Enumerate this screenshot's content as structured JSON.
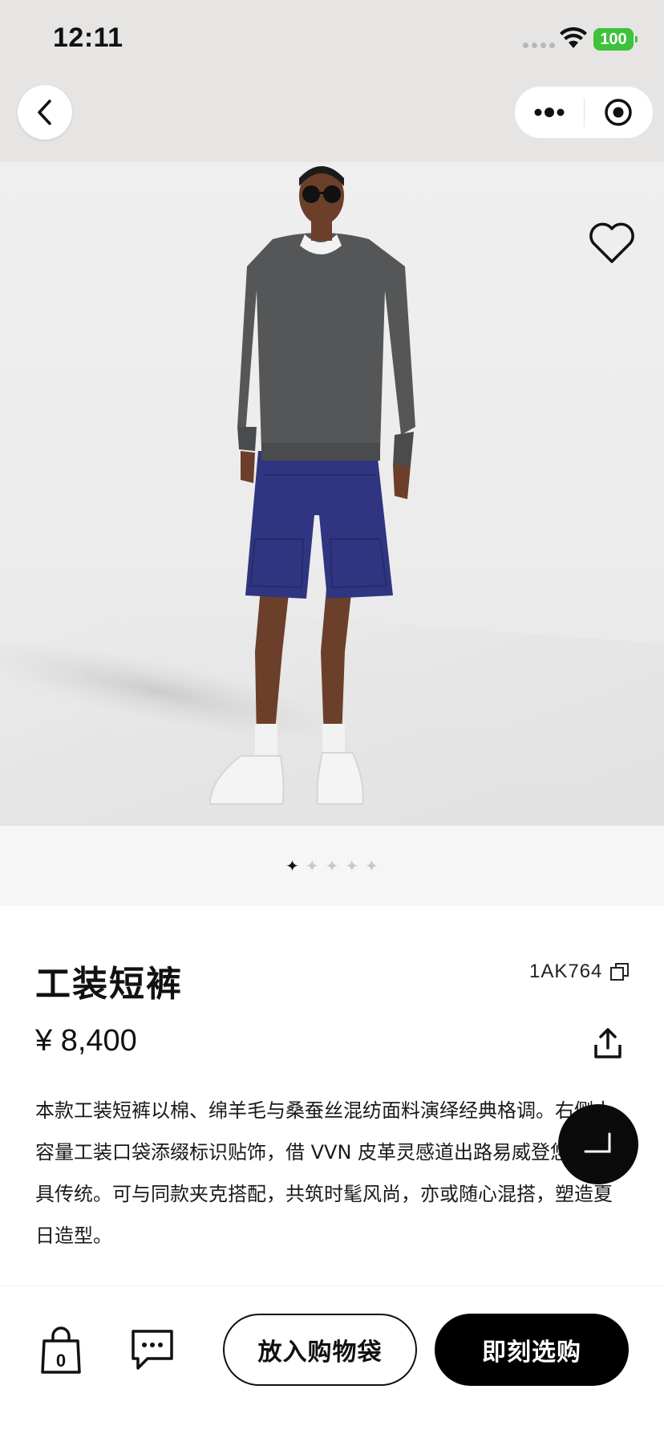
{
  "status_bar": {
    "time": "12:11",
    "battery": "100"
  },
  "product": {
    "title": "工装短裤",
    "sku": "1AK764",
    "price": "¥ 8,400",
    "description": "本款工装短裤以棉、绵羊毛与桑蚕丝混纺面料演绎经典格调。右侧大容量工装口袋添缀标识贴饰，借 VVN 皮革灵感道出路易威登悠久的皮具传统。可与同款夹克搭配，共筑时髦风尚，亦或随心混搭，塑造夏日造型。"
  },
  "gallery": {
    "dots": [
      "✦",
      "✦",
      "✦",
      "✦",
      "✦"
    ],
    "active_index": 0
  },
  "bottom_bar": {
    "bag_count": "0",
    "add_to_bag": "放入购物袋",
    "buy_now": "即刻选购"
  },
  "colors": {
    "accent": "#000000",
    "battery": "#3ec23a",
    "shorts": "#2f3580",
    "sweater": "#555657"
  }
}
